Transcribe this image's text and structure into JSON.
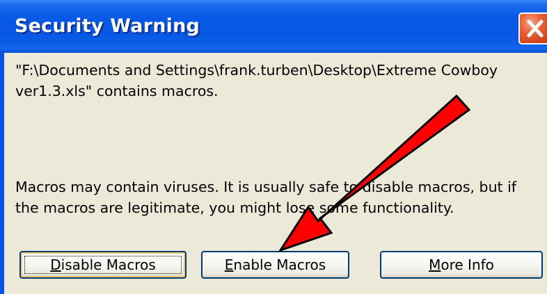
{
  "dialog": {
    "title": "Security Warning",
    "close_label": "Close",
    "message_file": "\"F:\\Documents and Settings\\frank.turben\\Desktop\\Extreme Cowboy ver1.3.xls\" contains macros.",
    "message_warning": "Macros may contain viruses. It is usually safe to disable macros, but if the macros are legitimate, you might lose some functionality."
  },
  "buttons": {
    "disable": {
      "accel": "D",
      "rest": "isable Macros"
    },
    "enable": {
      "accel": "E",
      "rest": "nable Macros"
    },
    "more": {
      "accel": "M",
      "rest": "ore Info"
    }
  },
  "annotation": {
    "arrow_color": "#ff0000",
    "arrow_icon": "red-arrow-icon"
  },
  "colors": {
    "titlebar": "#0756e4",
    "client": "#ece9d8",
    "close": "#d5421a"
  }
}
